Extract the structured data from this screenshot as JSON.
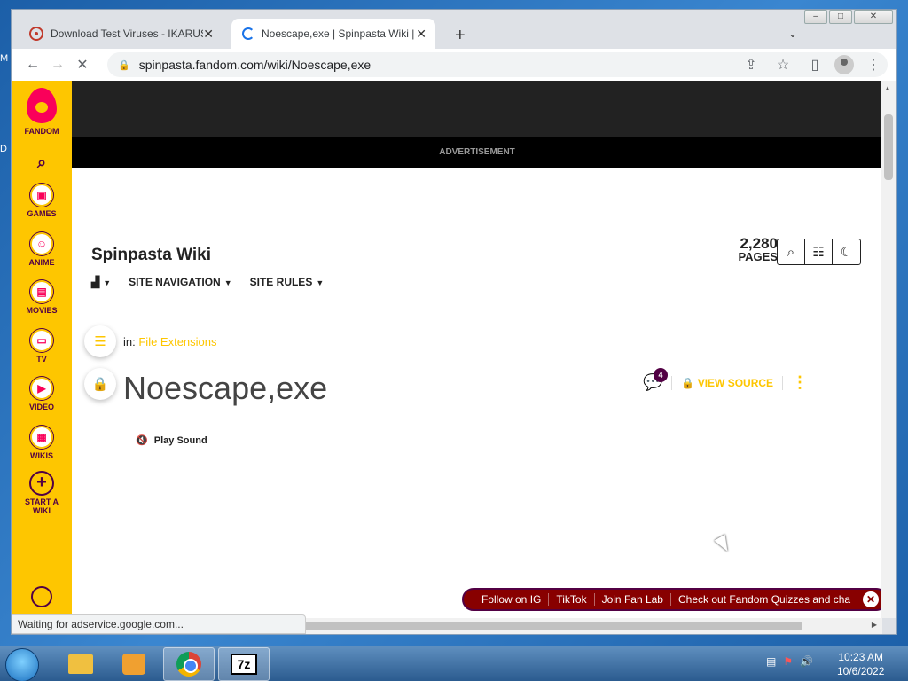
{
  "desktop": {
    "edge_text_1": "M",
    "edge_text_2": "D"
  },
  "browser": {
    "tabs": [
      {
        "title": "Download Test Viruses - IKARUS",
        "close": "✕"
      },
      {
        "title": "Noescape,exe | Spinpasta Wiki | F",
        "close": "✕"
      }
    ],
    "new_tab": "+",
    "url": "spinpasta.fandom.com/wiki/Noescape,exe",
    "status": "Waiting for adservice.google.com..."
  },
  "fandom_rail": {
    "logo_label": "FANDOM",
    "items": [
      {
        "label": "GAMES"
      },
      {
        "label": "ANIME"
      },
      {
        "label": "MOVIES"
      },
      {
        "label": "TV"
      },
      {
        "label": "VIDEO"
      },
      {
        "label": "WIKIS"
      },
      {
        "label": "START A WIKI"
      }
    ]
  },
  "ad": {
    "label": "ADVERTISEMENT"
  },
  "wiki": {
    "title": "Spinpasta Wiki",
    "pages_count": "2,280",
    "pages_label": "PAGES",
    "nav": [
      {
        "label": "SITE NAVIGATION"
      },
      {
        "label": "SITE RULES"
      }
    ]
  },
  "article": {
    "category_prefix": "in:",
    "category": "File Extensions",
    "title": "Noescape,exe",
    "comment_count": "4",
    "view_source": "VIEW SOURCE",
    "play_sound": "Play Sound"
  },
  "social": {
    "items": [
      "Follow on IG",
      "TikTok",
      "Join Fan Lab",
      "Check out Fandom Quizzes and cha"
    ]
  },
  "taskbar": {
    "apps": [
      "file-explorer",
      "media-player",
      "google-chrome",
      "7-zip"
    ],
    "seven_zip_label": "7z",
    "time": "10:23 AM",
    "date": "10/6/2022"
  },
  "colors": {
    "fandom_yellow": "#fec600",
    "fandom_pink": "#fa005a",
    "fandom_purple": "#520044"
  }
}
